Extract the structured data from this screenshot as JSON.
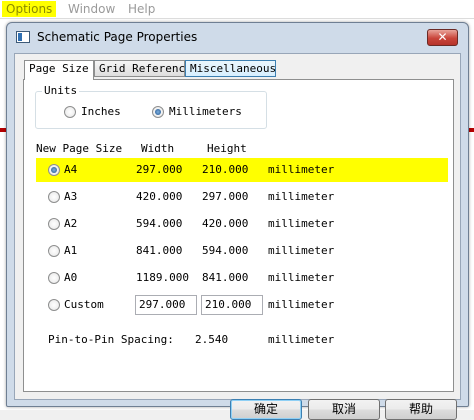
{
  "host": {
    "menu": [
      "Options",
      "Window",
      "Help"
    ]
  },
  "dialog": {
    "title": "Schematic Page Properties",
    "close_glyph": "✕",
    "tabs": [
      "Page Size",
      "Grid Reference",
      "Miscellaneous"
    ],
    "units": {
      "legend": "Units",
      "inches": "Inches",
      "millimeters": "Millimeters",
      "selected": "Millimeters"
    },
    "table": {
      "headers": {
        "size": "New Page Size",
        "width": "Width",
        "height": "Height"
      },
      "rows": [
        {
          "name": "A4",
          "width": "297.000",
          "height": "210.000",
          "unit": "millimeter"
        },
        {
          "name": "A3",
          "width": "420.000",
          "height": "297.000",
          "unit": "millimeter"
        },
        {
          "name": "A2",
          "width": "594.000",
          "height": "420.000",
          "unit": "millimeter"
        },
        {
          "name": "A1",
          "width": "841.000",
          "height": "594.000",
          "unit": "millimeter"
        },
        {
          "name": "A0",
          "width": "1189.000",
          "height": "841.000",
          "unit": "millimeter"
        }
      ],
      "custom": {
        "name": "Custom",
        "width": "297.000",
        "height": "210.000",
        "unit": "millimeter"
      },
      "selected": "A4"
    },
    "pin_spacing": {
      "label": "Pin-to-Pin Spacing:",
      "value": "2.540",
      "unit": "millimeter"
    },
    "buttons": {
      "ok": "确定",
      "cancel": "取消",
      "help": "帮助"
    }
  },
  "colors": {
    "highlight": "#ffff00",
    "close_button": "#c9453a",
    "window_frame": "#cfdbe9"
  }
}
